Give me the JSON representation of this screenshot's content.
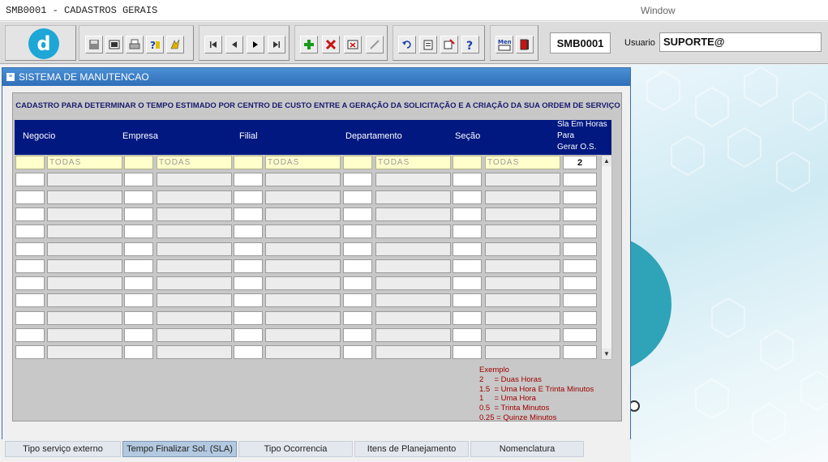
{
  "titlebar": {
    "app_title": "SMB0001 - CADASTROS GERAIS",
    "menu_window": "Window"
  },
  "toolbar": {
    "logo_letter": "d",
    "module_code": "SMB0001",
    "user_label": "Usuario",
    "user_value": "SUPORTE@"
  },
  "window": {
    "title": "SISTEMA DE MANUTENCAO",
    "subtitle": "CADASTRO PARA DETERMINAR O TEMPO ESTIMADO POR CENTRO DE CUSTO ENTRE A GERAÇÃO DA SOLICITAÇÃO E A CRIAÇÃO DA SUA ORDEM DE SERVIÇO",
    "columns": {
      "negocio": "Negocio",
      "empresa": "Empresa",
      "filial": "Filial",
      "departamento": "Departamento",
      "secao": "Seção",
      "sla_line1": "Sla Em Horas",
      "sla_line2": "Para",
      "sla_line3": "Gerar O.S."
    },
    "first_row": {
      "negocio": "TODAS",
      "empresa": "TODAS",
      "filial": "TODAS",
      "departamento": "TODAS",
      "secao": "TODAS",
      "sla": "2"
    },
    "example": {
      "title": "Exemplo",
      "lines": [
        "2     = Duas Horas",
        "1.5  = Uma Hora E Trinta Minutos",
        "1     = Uma Hora",
        "0.5  = Trinta Minutos",
        "0.25 = Quinze Minutos"
      ]
    }
  },
  "tabs": [
    "Tipo serviço externo",
    "Tempo Finalizar Sol. (SLA)",
    "Tipo Ocorrencia",
    "Itens de Planejamento",
    "Nomenclatura"
  ],
  "colors": {
    "header_bg": "#001880",
    "title_bg": "#2f6fb8",
    "highlight_row": "#ffffcc",
    "example_text": "#a00000",
    "logo": "#1ea6d6"
  }
}
